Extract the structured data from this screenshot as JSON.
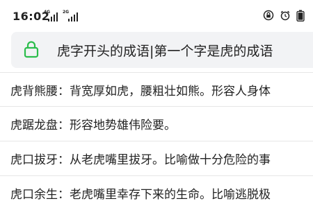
{
  "status_bar": {
    "time": "16:02",
    "network_1": "4G",
    "network_2": "2G",
    "icons": [
      "signal-icon",
      "signal-icon",
      "alarm-icon",
      "lock-rotation-icon",
      "battery-icon"
    ]
  },
  "search": {
    "query": "虎字开头的成语|第一个字是虎的成语",
    "lock_color": "#2bbd4b"
  },
  "results": [
    {
      "term": "虎背熊腰",
      "separator": "：",
      "definition": "背宽厚如虎，腰粗壮如熊。形容人身体"
    },
    {
      "term": "虎踞龙盘",
      "separator": "：",
      "definition": "形容地势雄伟险要。"
    },
    {
      "term": "虎口拔牙",
      "separator": "：",
      "definition": "从老虎嘴里拔牙。比喻做十分危险的事"
    },
    {
      "term": "虎口余生",
      "separator": "：",
      "definition": "老虎嘴里幸存下来的生命。比喻逃脱极"
    }
  ]
}
